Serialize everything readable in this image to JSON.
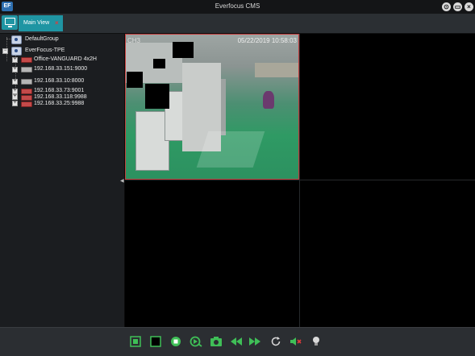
{
  "app": {
    "title": "Everfocus CMS",
    "logo_text": "EF"
  },
  "tabs": [
    {
      "label": "Main View"
    }
  ],
  "tree": {
    "default_group": "DefaultGroup",
    "site": "EverFocus-TPE",
    "devices": [
      {
        "label": "Office-VANGUARD 4x2H",
        "icon": "dvr-red-icon"
      },
      {
        "label": "192.168.33.151:9000",
        "icon": "dvr-grey-icon"
      },
      {
        "label": "192.168.33.10:8000",
        "icon": "dvr-grey-icon"
      },
      {
        "label": "192.168.33.73:9001",
        "icon": "dvr-red-icon"
      },
      {
        "label": "192.168.33.118:9988",
        "icon": "dvr-red-icon"
      },
      {
        "label": "192.168.33.25:9988",
        "icon": "dvr-red-icon"
      }
    ]
  },
  "camera": {
    "channel": "CH3",
    "timestamp": "05/22/2019 10:58:03"
  },
  "colors": {
    "accent": "#1f95a3",
    "selected_border": "#c23d3d",
    "toolbar_icon": "#3fbf57"
  },
  "toolbar_icons": [
    "fullscreen-icon",
    "single-view-icon",
    "stop-icon",
    "playback-icon",
    "snapshot-icon",
    "rewind-icon",
    "fast-forward-icon",
    "refresh-icon",
    "mute-icon",
    "light-icon"
  ]
}
